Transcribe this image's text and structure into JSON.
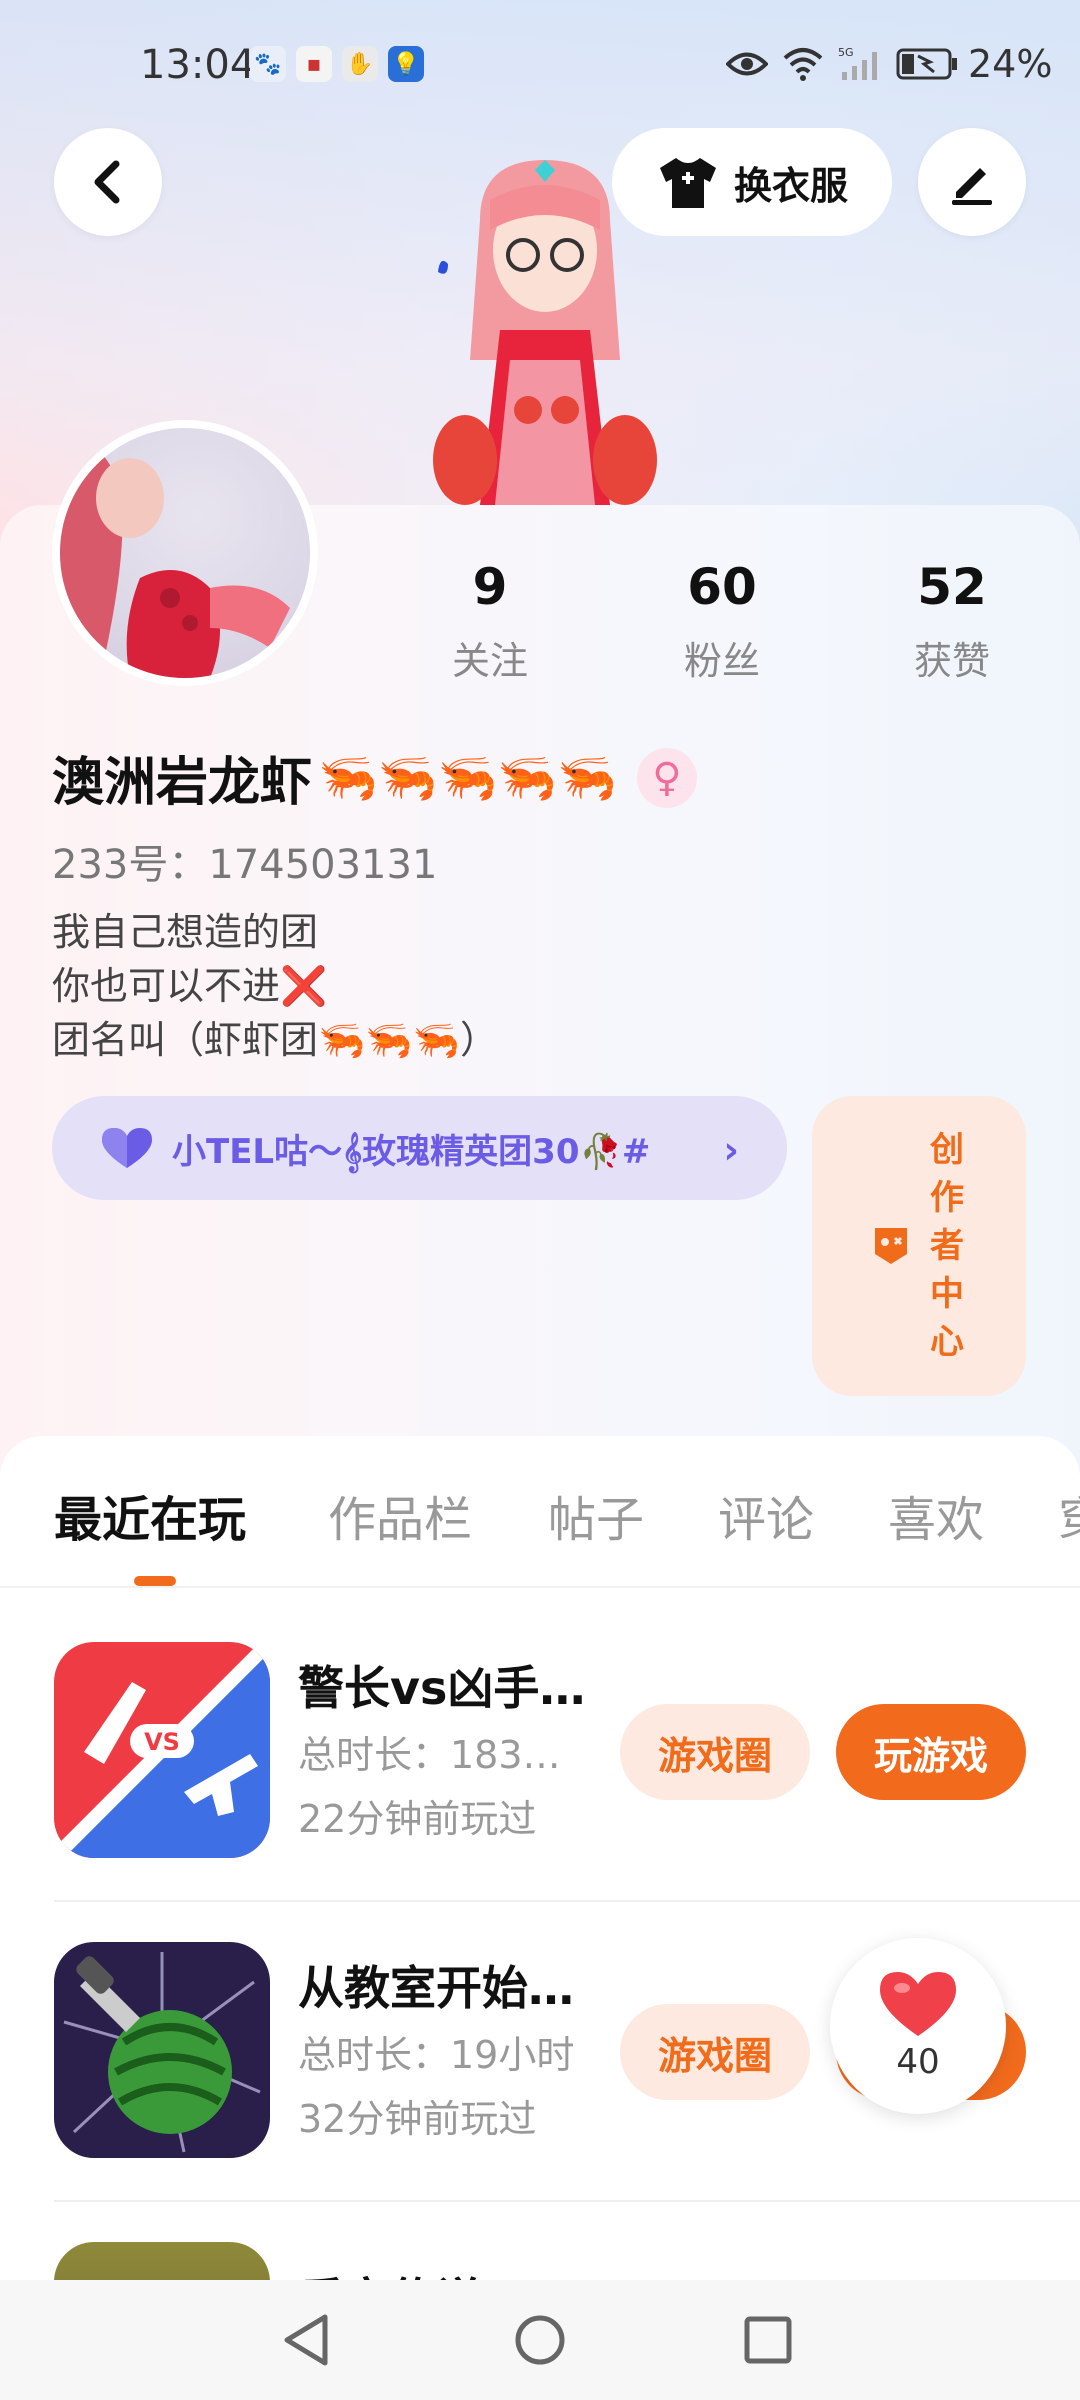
{
  "status_bar": {
    "time": "13:04",
    "battery": "24%",
    "network": "5G"
  },
  "header": {
    "change_clothes_label": "换衣服"
  },
  "profile": {
    "stats": [
      {
        "value": "9",
        "label": "关注"
      },
      {
        "value": "60",
        "label": "粉丝"
      },
      {
        "value": "52",
        "label": "获赞"
      }
    ],
    "nickname": "澳洲岩龙虾",
    "nickname_emoji": "🦐🦐🦐🦐🦐",
    "gender_symbol": "♀",
    "uid": "233号：174503131",
    "bio": [
      "我自己想造的团",
      "你也可以不进❌",
      "团名叫（虾虾团🦐🦐🦐）"
    ],
    "group_label": "小TEL咕～𝄞玫瑰精英团30🥀#",
    "creator_label": "创作者中心"
  },
  "tabs": [
    {
      "label": "最近在玩",
      "active": true
    },
    {
      "label": "作品栏",
      "active": false
    },
    {
      "label": "帖子",
      "active": false
    },
    {
      "label": "评论",
      "active": false
    },
    {
      "label": "喜欢",
      "active": false
    },
    {
      "label": "穿",
      "active": false
    }
  ],
  "games": [
    {
      "title": "警长vs凶手…",
      "duration": "总时长：183…",
      "last_played": "22分钟前玩过",
      "circle_label": "游戏圈",
      "play_label": "玩游戏"
    },
    {
      "title": "从教室开始…",
      "duration": "总时长：19小时",
      "last_played": "32分钟前玩过",
      "circle_label": "游戏圈",
      "play_label": ""
    },
    {
      "title": "乐宝传说",
      "duration": "",
      "last_played": "",
      "circle_label": "",
      "play_label": ""
    }
  ],
  "like_float": {
    "count": "40"
  },
  "colors": {
    "accent": "#f26b1d",
    "group_purple": "#6b5ce6",
    "like_red": "#f0404a"
  }
}
